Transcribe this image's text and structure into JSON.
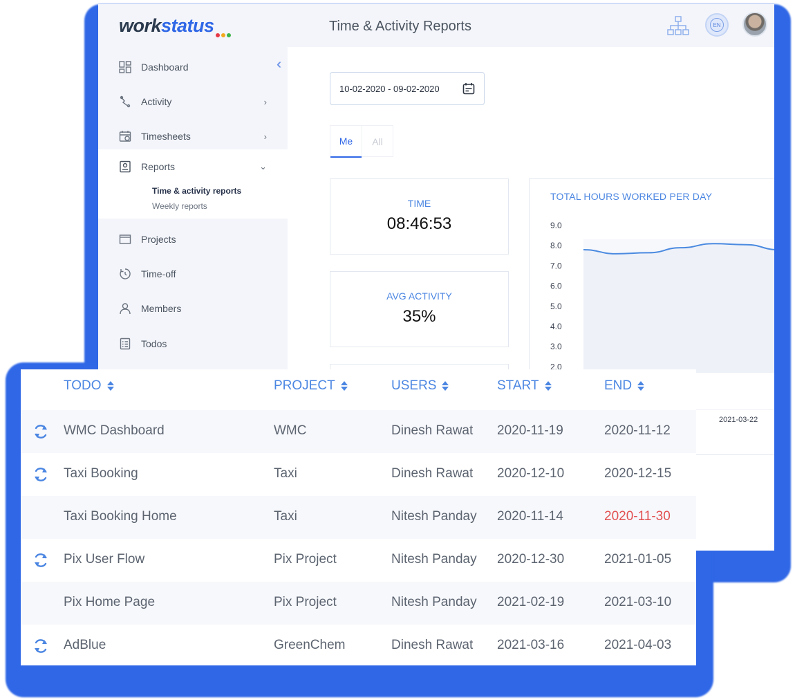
{
  "header": {
    "logo_main": "work",
    "logo_accent": "status",
    "logo_dot_colors": [
      "#e63946",
      "#f4a91d",
      "#3bb54a"
    ],
    "page_title": "Time & Activity Reports",
    "org_icon": "org-chart-icon",
    "language": "EN"
  },
  "sidebar": {
    "collapse_icon": "double-chevron-left-icon",
    "items": [
      {
        "label": "Dashboard",
        "icon": "dashboard-icon",
        "has_chevron": false
      },
      {
        "label": "Activity",
        "icon": "activity-icon",
        "has_chevron": true
      },
      {
        "label": "Timesheets",
        "icon": "calendar-icon",
        "has_chevron": true
      },
      {
        "label": "Reports",
        "icon": "report-icon",
        "expanded": true
      },
      {
        "label": "Projects",
        "icon": "folder-icon"
      },
      {
        "label": "Time-off",
        "icon": "timer-icon"
      },
      {
        "label": "Members",
        "icon": "person-icon"
      },
      {
        "label": "Todos",
        "icon": "checklist-icon"
      }
    ],
    "reports_sub": {
      "active": "Time & activity reports",
      "other": "Weekly reports"
    },
    "chevron_right": "›",
    "chevron_down": "⌄"
  },
  "filters": {
    "date_range": "10-02-2020 - 09-02-2020",
    "tabs": [
      "Me",
      "All"
    ],
    "active_tab": "Me"
  },
  "stats": {
    "time": {
      "label": "TIME",
      "value": "08:46:53"
    },
    "activity": {
      "label": "AVG ACTIVITY",
      "value": "35%"
    }
  },
  "chart_data": {
    "type": "area",
    "title": "TOTAL HOURS WORKED PER DAY",
    "y_ticks": [
      "9.0",
      "8.0",
      "7.0",
      "6.0",
      "5.0",
      "4.0",
      "3.0",
      "2.0"
    ],
    "ylim": [
      2.0,
      9.0
    ],
    "series": [
      {
        "values": [
          7.8,
          7.6,
          7.65,
          7.9,
          8.1,
          8.05,
          7.8
        ]
      }
    ],
    "x_label_visible": "2021-03-22",
    "color": "#4a8ae0"
  },
  "todo_table": {
    "columns": [
      "TODO",
      "PROJECT",
      "USERS",
      "START",
      "END"
    ],
    "rows": [
      {
        "recurring": true,
        "todo": "WMC Dashboard",
        "project": "WMC",
        "user": "Dinesh Rawat",
        "start": "2020-11-19",
        "end": "2020-11-12",
        "overdue": false
      },
      {
        "recurring": true,
        "todo": "Taxi Booking",
        "project": "Taxi",
        "user": "Dinesh Rawat",
        "start": "2020-12-10",
        "end": "2020-12-15",
        "overdue": false
      },
      {
        "recurring": false,
        "todo": "Taxi Booking Home",
        "project": "Taxi",
        "user": "Nitesh Panday",
        "start": "2020-11-14",
        "end": "2020-11-30",
        "overdue": true
      },
      {
        "recurring": true,
        "todo": "Pix User Flow",
        "project": "Pix Project",
        "user": "Nitesh Panday",
        "start": "2020-12-30",
        "end": "2021-01-05",
        "overdue": false
      },
      {
        "recurring": false,
        "todo": "Pix Home Page",
        "project": "Pix Project",
        "user": "Nitesh Panday",
        "start": "2021-02-19",
        "end": "2021-03-10",
        "overdue": false
      },
      {
        "recurring": true,
        "todo": "AdBlue",
        "project": "GreenChem",
        "user": "Dinesh Rawat",
        "start": "2021-03-16",
        "end": "2021-04-03",
        "overdue": false
      }
    ],
    "overdue_color": "#e25252",
    "recurring_icon": "refresh-icon"
  }
}
